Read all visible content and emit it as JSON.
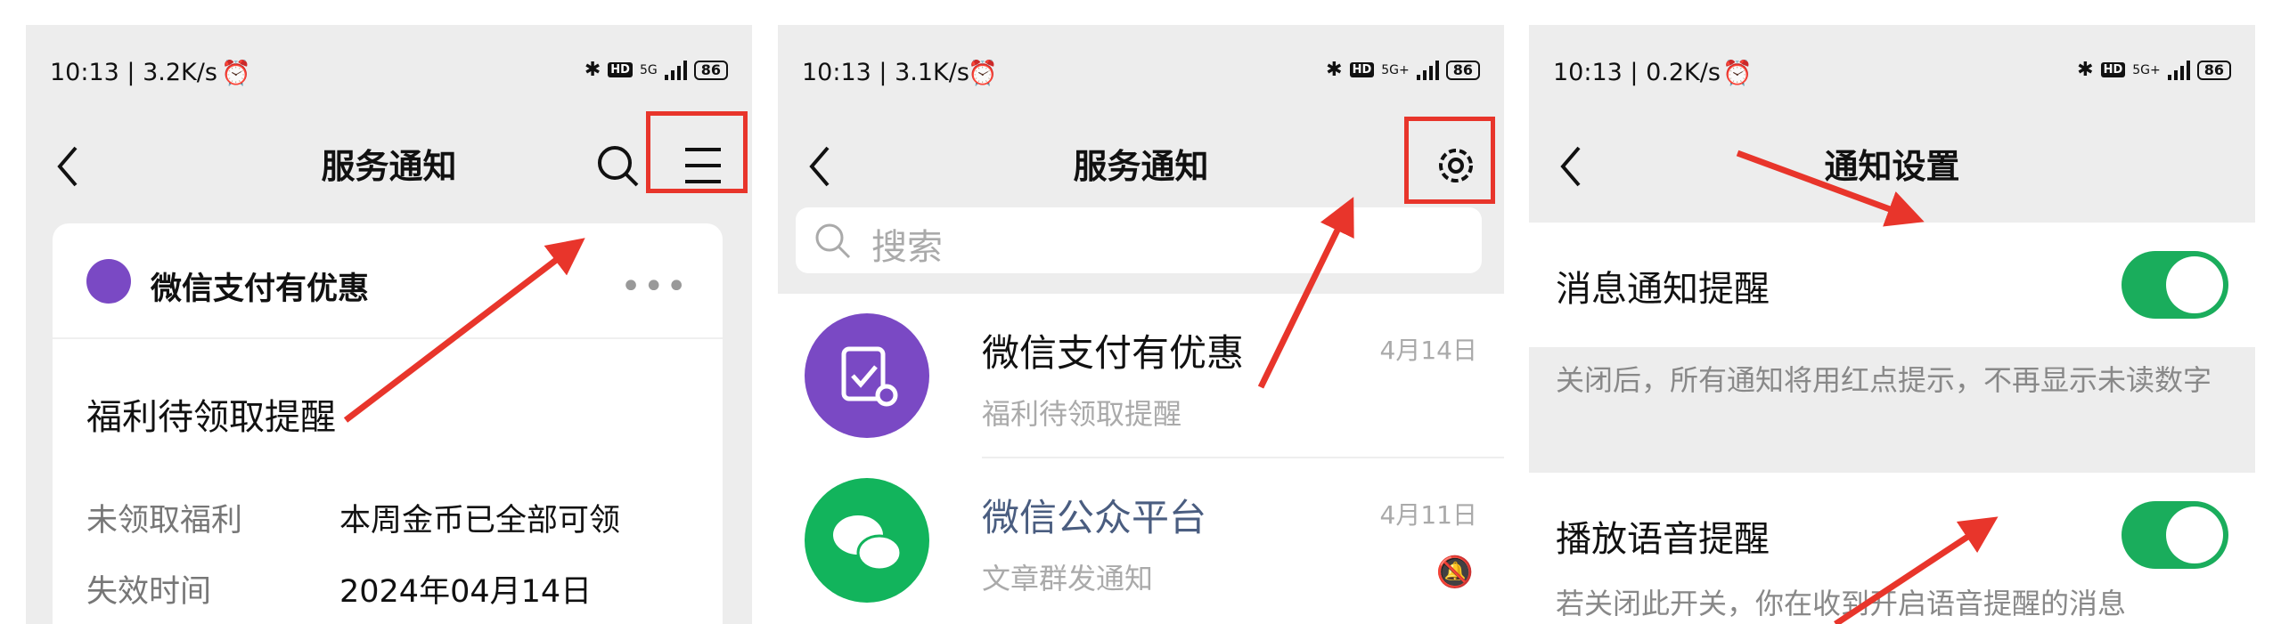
{
  "panel1": {
    "status": {
      "time": "10:13 | 3.2K/s",
      "net": "5G",
      "battery": "86"
    },
    "title": "服务通知",
    "card": {
      "sender": "微信支付有优惠",
      "heading": "福利待领取提醒",
      "rows": [
        {
          "key": "未领取福利",
          "value": "本周金币已全部可领"
        },
        {
          "key": "失效时间",
          "value": "2024年04月14日"
        }
      ]
    }
  },
  "panel2": {
    "status": {
      "time": "10:13 | 3.1K/s",
      "net": "5G+",
      "battery": "86"
    },
    "title": "服务通知",
    "search_placeholder": "搜索",
    "items": [
      {
        "title": "微信支付有优惠",
        "subtitle": "福利待领取提醒",
        "date": "4月14日",
        "color": "#7a49c4"
      },
      {
        "title": "微信公众平台",
        "subtitle": "文章群发通知",
        "date": "4月11日",
        "color": "#12b45c"
      }
    ]
  },
  "panel3": {
    "status": {
      "time": "10:13 | 0.2K/s",
      "net": "5G+",
      "battery": "86"
    },
    "title": "通知设置",
    "settings": [
      {
        "label": "消息通知提醒",
        "on": true,
        "desc": "关闭后，所有通知将用红点提示，不再显示未读数字"
      },
      {
        "label": "播放语音提醒",
        "on": true,
        "desc": "若关闭此开关，你在收到开启语音提醒的消息"
      }
    ]
  },
  "colors": {
    "highlight": "#e8352b",
    "toggle_on": "#1aad5c"
  }
}
